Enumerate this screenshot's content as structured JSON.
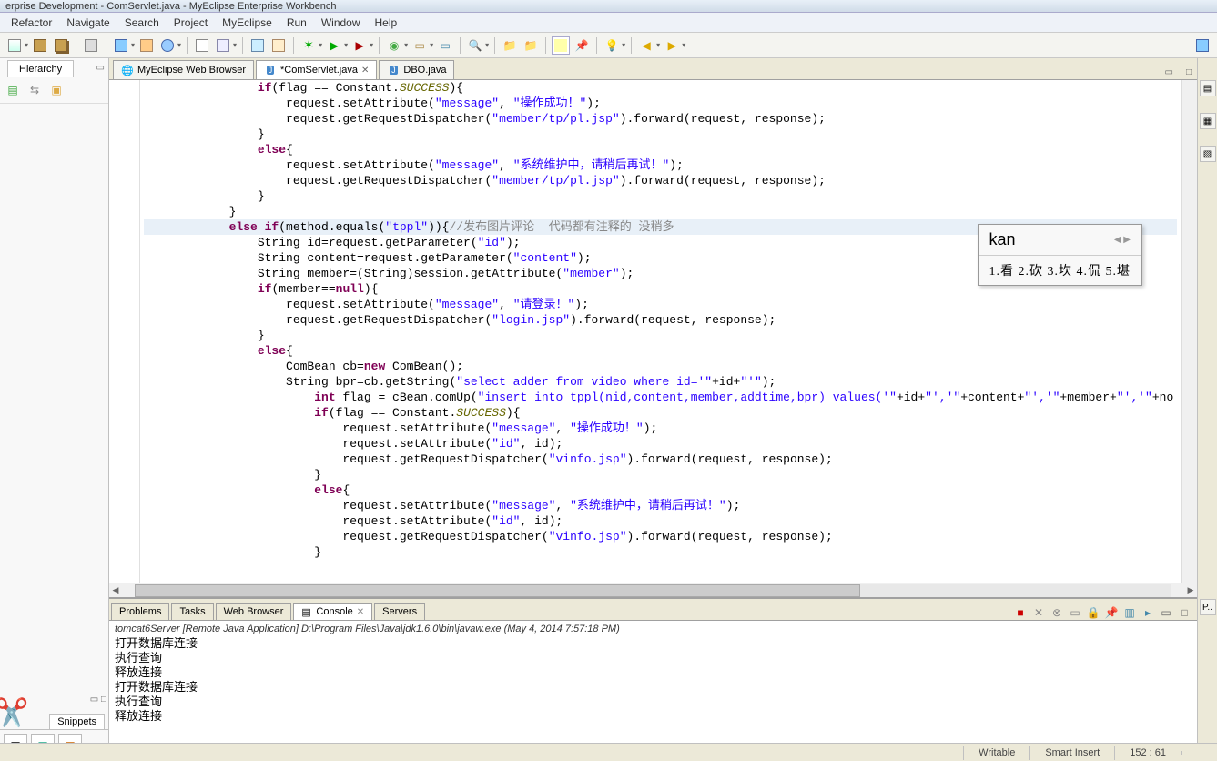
{
  "title": "erprise Development - ComServlet.java - MyEclipse Enterprise Workbench",
  "menu": [
    "Refactor",
    "Navigate",
    "Search",
    "Project",
    "MyEclipse",
    "Run",
    "Window",
    "Help"
  ],
  "left": {
    "hierarchy": "Hierarchy",
    "snippets": "Snippets"
  },
  "tabs": [
    {
      "label": "MyEclipse Web Browser",
      "icon": "globe",
      "active": false,
      "closable": false
    },
    {
      "label": "*ComServlet.java",
      "icon": "java",
      "active": true,
      "closable": true
    },
    {
      "label": "DBO.java",
      "icon": "java",
      "active": false,
      "closable": false
    }
  ],
  "code": {
    "lines": [
      [
        {
          "ind": 16
        },
        {
          "t": "if",
          "c": "kw"
        },
        {
          "t": "(flag == Constant."
        },
        {
          "t": "SUCCESS",
          "c": "fld"
        },
        {
          "t": "){"
        }
      ],
      [
        {
          "ind": 20
        },
        {
          "t": "request.setAttribute("
        },
        {
          "t": "\"message\"",
          "c": "str"
        },
        {
          "t": ", "
        },
        {
          "t": "\"操作成功！\"",
          "c": "str"
        },
        {
          "t": ");"
        }
      ],
      [
        {
          "ind": 20
        },
        {
          "t": "request.getRequestDispatcher("
        },
        {
          "t": "\"member/tp/pl.jsp\"",
          "c": "str"
        },
        {
          "t": ").forward(request, response);"
        }
      ],
      [
        {
          "ind": 16
        },
        {
          "t": "}"
        }
      ],
      [
        {
          "ind": 16
        },
        {
          "t": "else",
          "c": "kw"
        },
        {
          "t": "{"
        }
      ],
      [
        {
          "ind": 20
        },
        {
          "t": "request.setAttribute("
        },
        {
          "t": "\"message\"",
          "c": "str"
        },
        {
          "t": ", "
        },
        {
          "t": "\"系统维护中，请稍后再试！\"",
          "c": "str"
        },
        {
          "t": ");"
        }
      ],
      [
        {
          "ind": 20
        },
        {
          "t": "request.getRequestDispatcher("
        },
        {
          "t": "\"member/tp/pl.jsp\"",
          "c": "str"
        },
        {
          "t": ").forward(request, response);"
        }
      ],
      [
        {
          "ind": 16
        },
        {
          "t": "}"
        }
      ],
      [
        {
          "ind": 12
        },
        {
          "t": "}"
        }
      ],
      [
        {
          "ind": 12,
          "hl": true
        },
        {
          "t": "else if",
          "c": "kw"
        },
        {
          "t": "(method.equals("
        },
        {
          "t": "\"tppl\"",
          "c": "str"
        },
        {
          "t": ")){"
        },
        {
          "t": "//发布图片评论  代码都有注释的 没稍多",
          "c": "cmt"
        }
      ],
      [
        {
          "ind": 16
        },
        {
          "t": "String id=request.getParameter("
        },
        {
          "t": "\"id\"",
          "c": "str"
        },
        {
          "t": ");"
        }
      ],
      [
        {
          "ind": 16
        },
        {
          "t": "String content=request.getParameter("
        },
        {
          "t": "\"content\"",
          "c": "str"
        },
        {
          "t": ");"
        }
      ],
      [
        {
          "ind": 16
        },
        {
          "t": "String member=(String)session.getAttribute("
        },
        {
          "t": "\"member\"",
          "c": "str"
        },
        {
          "t": ");"
        }
      ],
      [
        {
          "ind": 16
        },
        {
          "t": "if",
          "c": "kw"
        },
        {
          "t": "(member=="
        },
        {
          "t": "null",
          "c": "kw"
        },
        {
          "t": "){"
        }
      ],
      [
        {
          "ind": 20
        },
        {
          "t": "request.setAttribute("
        },
        {
          "t": "\"message\"",
          "c": "str"
        },
        {
          "t": ", "
        },
        {
          "t": "\"请登录！\"",
          "c": "str"
        },
        {
          "t": ");"
        }
      ],
      [
        {
          "ind": 20
        },
        {
          "t": "request.getRequestDispatcher("
        },
        {
          "t": "\"login.jsp\"",
          "c": "str"
        },
        {
          "t": ").forward(request, response);"
        }
      ],
      [
        {
          "ind": 16
        },
        {
          "t": "}"
        }
      ],
      [
        {
          "ind": 16
        },
        {
          "t": "else",
          "c": "kw"
        },
        {
          "t": "{"
        }
      ],
      [
        {
          "ind": 20
        },
        {
          "t": "ComBean cb="
        },
        {
          "t": "new",
          "c": "kw"
        },
        {
          "t": " ComBean();"
        }
      ],
      [
        {
          "ind": 20
        },
        {
          "t": "String bpr=cb.getString("
        },
        {
          "t": "\"select adder from video where id='\"",
          "c": "str"
        },
        {
          "t": "+id+"
        },
        {
          "t": "\"'\"",
          "c": "str"
        },
        {
          "t": ");"
        }
      ],
      [
        {
          "ind": 24
        },
        {
          "t": "int",
          "c": "kw"
        },
        {
          "t": " flag = cBean.comUp("
        },
        {
          "t": "\"insert into tppl(nid,content,member,addtime,bpr) values('\"",
          "c": "str"
        },
        {
          "t": "+id+"
        },
        {
          "t": "\"','\"",
          "c": "str"
        },
        {
          "t": "+content+"
        },
        {
          "t": "\"','\"",
          "c": "str"
        },
        {
          "t": "+member+"
        },
        {
          "t": "\"','\"",
          "c": "str"
        },
        {
          "t": "+no"
        }
      ],
      [
        {
          "ind": 24
        },
        {
          "t": "if",
          "c": "kw"
        },
        {
          "t": "(flag == Constant."
        },
        {
          "t": "SUCCESS",
          "c": "fld"
        },
        {
          "t": "){"
        }
      ],
      [
        {
          "ind": 28
        },
        {
          "t": "request.setAttribute("
        },
        {
          "t": "\"message\"",
          "c": "str"
        },
        {
          "t": ", "
        },
        {
          "t": "\"操作成功！\"",
          "c": "str"
        },
        {
          "t": ");"
        }
      ],
      [
        {
          "ind": 28
        },
        {
          "t": "request.setAttribute("
        },
        {
          "t": "\"id\"",
          "c": "str"
        },
        {
          "t": ", id);"
        }
      ],
      [
        {
          "ind": 28
        },
        {
          "t": "request.getRequestDispatcher("
        },
        {
          "t": "\"vinfo.jsp\"",
          "c": "str"
        },
        {
          "t": ").forward(request, response);"
        }
      ],
      [
        {
          "ind": 24
        },
        {
          "t": "}"
        }
      ],
      [
        {
          "ind": 24
        },
        {
          "t": "else",
          "c": "kw"
        },
        {
          "t": "{"
        }
      ],
      [
        {
          "ind": 28
        },
        {
          "t": "request.setAttribute("
        },
        {
          "t": "\"message\"",
          "c": "str"
        },
        {
          "t": ", "
        },
        {
          "t": "\"系统维护中，请稍后再试！\"",
          "c": "str"
        },
        {
          "t": ");"
        }
      ],
      [
        {
          "ind": 28
        },
        {
          "t": "request.setAttribute("
        },
        {
          "t": "\"id\"",
          "c": "str"
        },
        {
          "t": ", id);"
        }
      ],
      [
        {
          "ind": 28
        },
        {
          "t": "request.getRequestDispatcher("
        },
        {
          "t": "\"vinfo.jsp\"",
          "c": "str"
        },
        {
          "t": ").forward(request, response);"
        }
      ],
      [
        {
          "ind": 24
        },
        {
          "t": "}"
        }
      ]
    ]
  },
  "ime": {
    "input": "kan",
    "candidates": "1.看  2.砍  3.坎  4.侃  5.堪"
  },
  "bottom": {
    "tabs": [
      "Problems",
      "Tasks",
      "Web Browser",
      "Console",
      "Servers"
    ],
    "activeTab": "Console",
    "header": "tomcat6Server [Remote Java Application] D:\\Program Files\\Java\\jdk1.6.0\\bin\\javaw.exe (May 4, 2014 7:57:18 PM)",
    "lines": [
      "打开数据库连接",
      "执行查询",
      "释放连接",
      "打开数据库连接",
      "执行查询",
      "释放连接"
    ]
  },
  "status": {
    "writable": "Writable",
    "insert": "Smart Insert",
    "pos": "152 : 61"
  }
}
